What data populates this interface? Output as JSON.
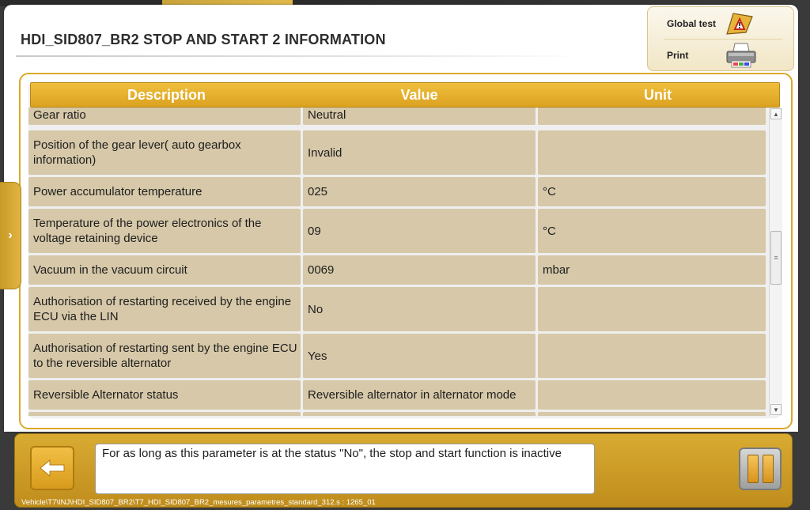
{
  "page": {
    "title": "HDI_SID807_BR2  STOP AND START 2 INFORMATION"
  },
  "actions": {
    "global_test_label": "Global test",
    "print_label": "Print"
  },
  "table": {
    "headers": [
      "Description",
      "Value",
      "Unit"
    ],
    "rows": [
      {
        "description": "Gear ratio",
        "value": "Neutral",
        "unit": ""
      },
      {
        "description": "Position of the gear lever( auto gearbox information)",
        "value": "Invalid",
        "unit": ""
      },
      {
        "description": "Power accumulator temperature",
        "value": "025",
        "unit": "°C"
      },
      {
        "description": "Temperature of the power electronics of the voltage retaining device",
        "value": "09",
        "unit": "°C"
      },
      {
        "description": "Vacuum in the vacuum circuit",
        "value": "0069",
        "unit": "mbar"
      },
      {
        "description": "Authorisation of restarting received by the engine ECU via the LIN",
        "value": "No",
        "unit": ""
      },
      {
        "description": "Authorisation of restarting sent by the engine ECU to the reversible alternator",
        "value": "Yes",
        "unit": ""
      },
      {
        "description": "Reversible Alternator status",
        "value": "Reversible alternator in alternator mode",
        "unit": ""
      }
    ]
  },
  "footer": {
    "info_text": "For as long as this parameter is at the status \"No\", the stop and start function is inactive",
    "path": "Vehicle\\T7\\INJ\\HDI_SID807_BR2\\T7_HDI_SID807_BR2_mesures_parametres_standard_312.s : 1265_01"
  },
  "side_tab": {
    "glyph": "›"
  },
  "colors": {
    "accent": "#dba221",
    "row_bg": "#d6c8a8",
    "frame": "#d9a92a"
  }
}
